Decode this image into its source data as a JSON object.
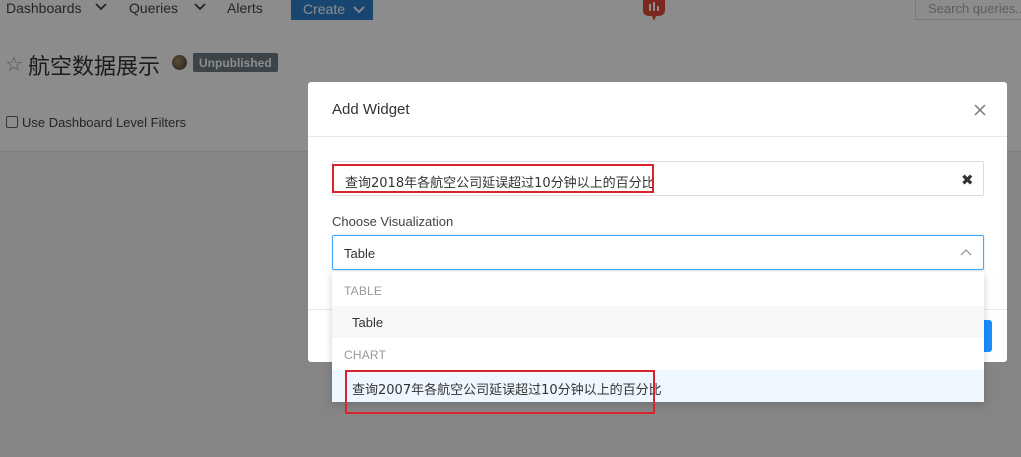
{
  "navbar": {
    "dashboards_label": "Dashboards",
    "queries_label": "Queries",
    "alerts_label": "Alerts",
    "create_label": "Create",
    "search_placeholder": "Search queries..."
  },
  "dashboard": {
    "title": "航空数据展示",
    "badge": "Unpublished",
    "filter_label": "Use Dashboard Level Filters"
  },
  "modal": {
    "title": "Add Widget",
    "query_value": "查询2018年各航空公司延误超过10分钟以上的百分比",
    "visualization_label": "Choose Visualization",
    "visualization_value": "Table"
  },
  "dropdown": {
    "groups": [
      {
        "label": "TABLE",
        "options": [
          "Table"
        ]
      },
      {
        "label": "CHART",
        "options": [
          "查询2007年各航空公司延误超过10分钟以上的百分比"
        ]
      }
    ]
  },
  "colors": {
    "accent": "#2f80cc",
    "focus": "#40a9ff",
    "highlight_box": "#d9232d",
    "badge": "#6e7c86"
  },
  "icons": {
    "star": "star-icon",
    "close": "close-icon",
    "clear": "clear-icon",
    "chevron": "chevron-up-icon",
    "logo": "redash-logo-icon"
  }
}
